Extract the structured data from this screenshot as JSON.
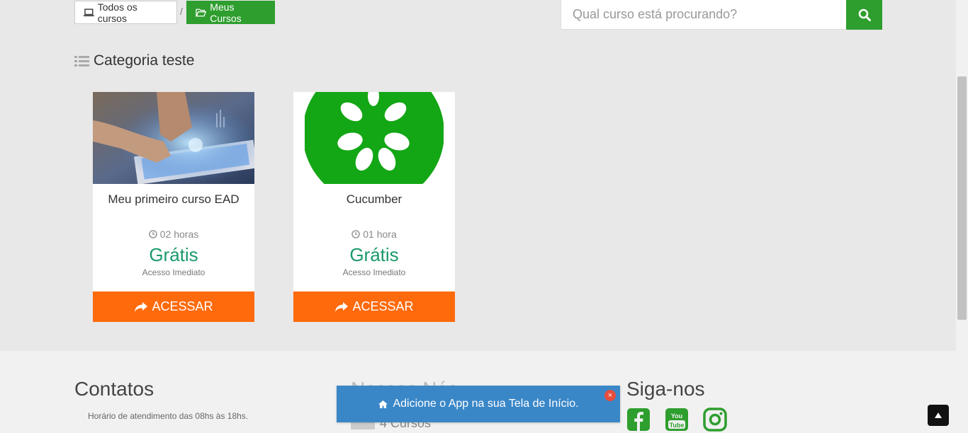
{
  "breadcrumb": {
    "all_courses_label": "Todos os cursos",
    "separator": "/",
    "my_courses_label": "Meus Cursos"
  },
  "search": {
    "placeholder": "Qual curso está procurando?"
  },
  "category": {
    "title": "Categoria teste"
  },
  "courses": [
    {
      "title": "Meu primeiro curso EAD",
      "duration": "02 horas",
      "price": "Grátis",
      "access": "Acesso Imediato",
      "button_label": "ACESSAR"
    },
    {
      "title": "Cucumber",
      "duration": "01 hora",
      "price": "Grátis",
      "access": "Acesso Imediato",
      "button_label": "ACESSAR"
    }
  ],
  "footer": {
    "contacts_title": "Contatos",
    "hours_text": "Horário de atendimento das 08hs às 18hs.",
    "about_title": "Nossos Nós",
    "courses_count": "4 Cursos",
    "follow_title": "Siga-nos"
  },
  "banner": {
    "text": "Adicione o App na sua Tela de Início.",
    "close_label": "×"
  },
  "colors": {
    "brand_green": "#2e9e2e",
    "price_green": "#1a9a6a",
    "accent_orange": "#ff6a0c",
    "banner_blue": "#3a87c8"
  },
  "icons": [
    "laptop-icon",
    "folder-open-icon",
    "search-icon",
    "list-icon",
    "clock-icon",
    "share-icon",
    "home-icon",
    "close-icon",
    "facebook-icon",
    "youtube-icon",
    "instagram-icon",
    "arrow-up-icon"
  ]
}
